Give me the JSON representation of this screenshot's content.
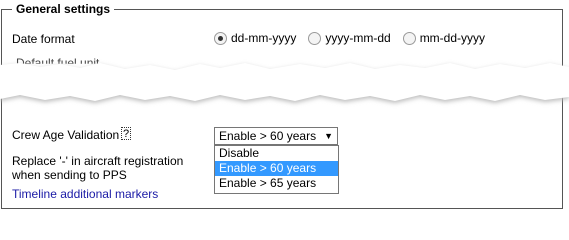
{
  "section": {
    "legend": "General settings"
  },
  "date_format": {
    "label": "Date format",
    "options": [
      "dd-mm-yyyy",
      "yyyy-mm-dd",
      "mm-dd-yyyy"
    ],
    "selected": "dd-mm-yyyy"
  },
  "fuel_unit": {
    "label_partial": "Default fuel unit"
  },
  "crew_age": {
    "label": "Crew Age Validation",
    "help": "?",
    "selected": "Enable > 60 years",
    "options": [
      "Disable",
      "Enable > 60 years",
      "Enable > 65 years"
    ]
  },
  "replace_dash": {
    "label_line1": "Replace '-' in aircraft registration",
    "label_line2": "when sending to PPS"
  },
  "timeline": {
    "label": "Timeline additional markers"
  },
  "colors": {
    "accent": "#3399ff",
    "link": "#1a1aa6"
  }
}
